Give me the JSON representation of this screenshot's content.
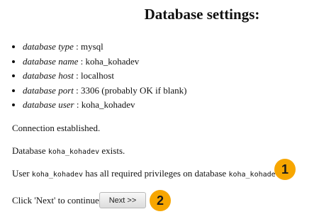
{
  "title": "Database settings:",
  "settings": [
    {
      "key": "database type",
      "sep": " : ",
      "value": "mysql"
    },
    {
      "key": "database name",
      "sep": " : ",
      "value": "koha_kohadev"
    },
    {
      "key": "database host",
      "sep": " : ",
      "value": "localhost"
    },
    {
      "key": "database port",
      "sep": " : ",
      "value": "3306 (probably OK if blank)"
    },
    {
      "key": "database user",
      "sep": " : ",
      "value": "koha_kohadev"
    }
  ],
  "messages": {
    "connection": "Connection established.",
    "db_exists_prefix": "Database ",
    "db_name": "koha_kohadev",
    "db_exists_suffix": " exists.",
    "user_prefix": "User ",
    "user_name": "koha_kohadev",
    "user_middle": " has all required privileges on database ",
    "user_db": "koha_kohadev",
    "user_suffix": "."
  },
  "footer": {
    "prompt": "Click 'Next' to continue",
    "next_label": "Next >>"
  },
  "badges": {
    "one": "1",
    "two": "2",
    "color": "#f7a600"
  }
}
